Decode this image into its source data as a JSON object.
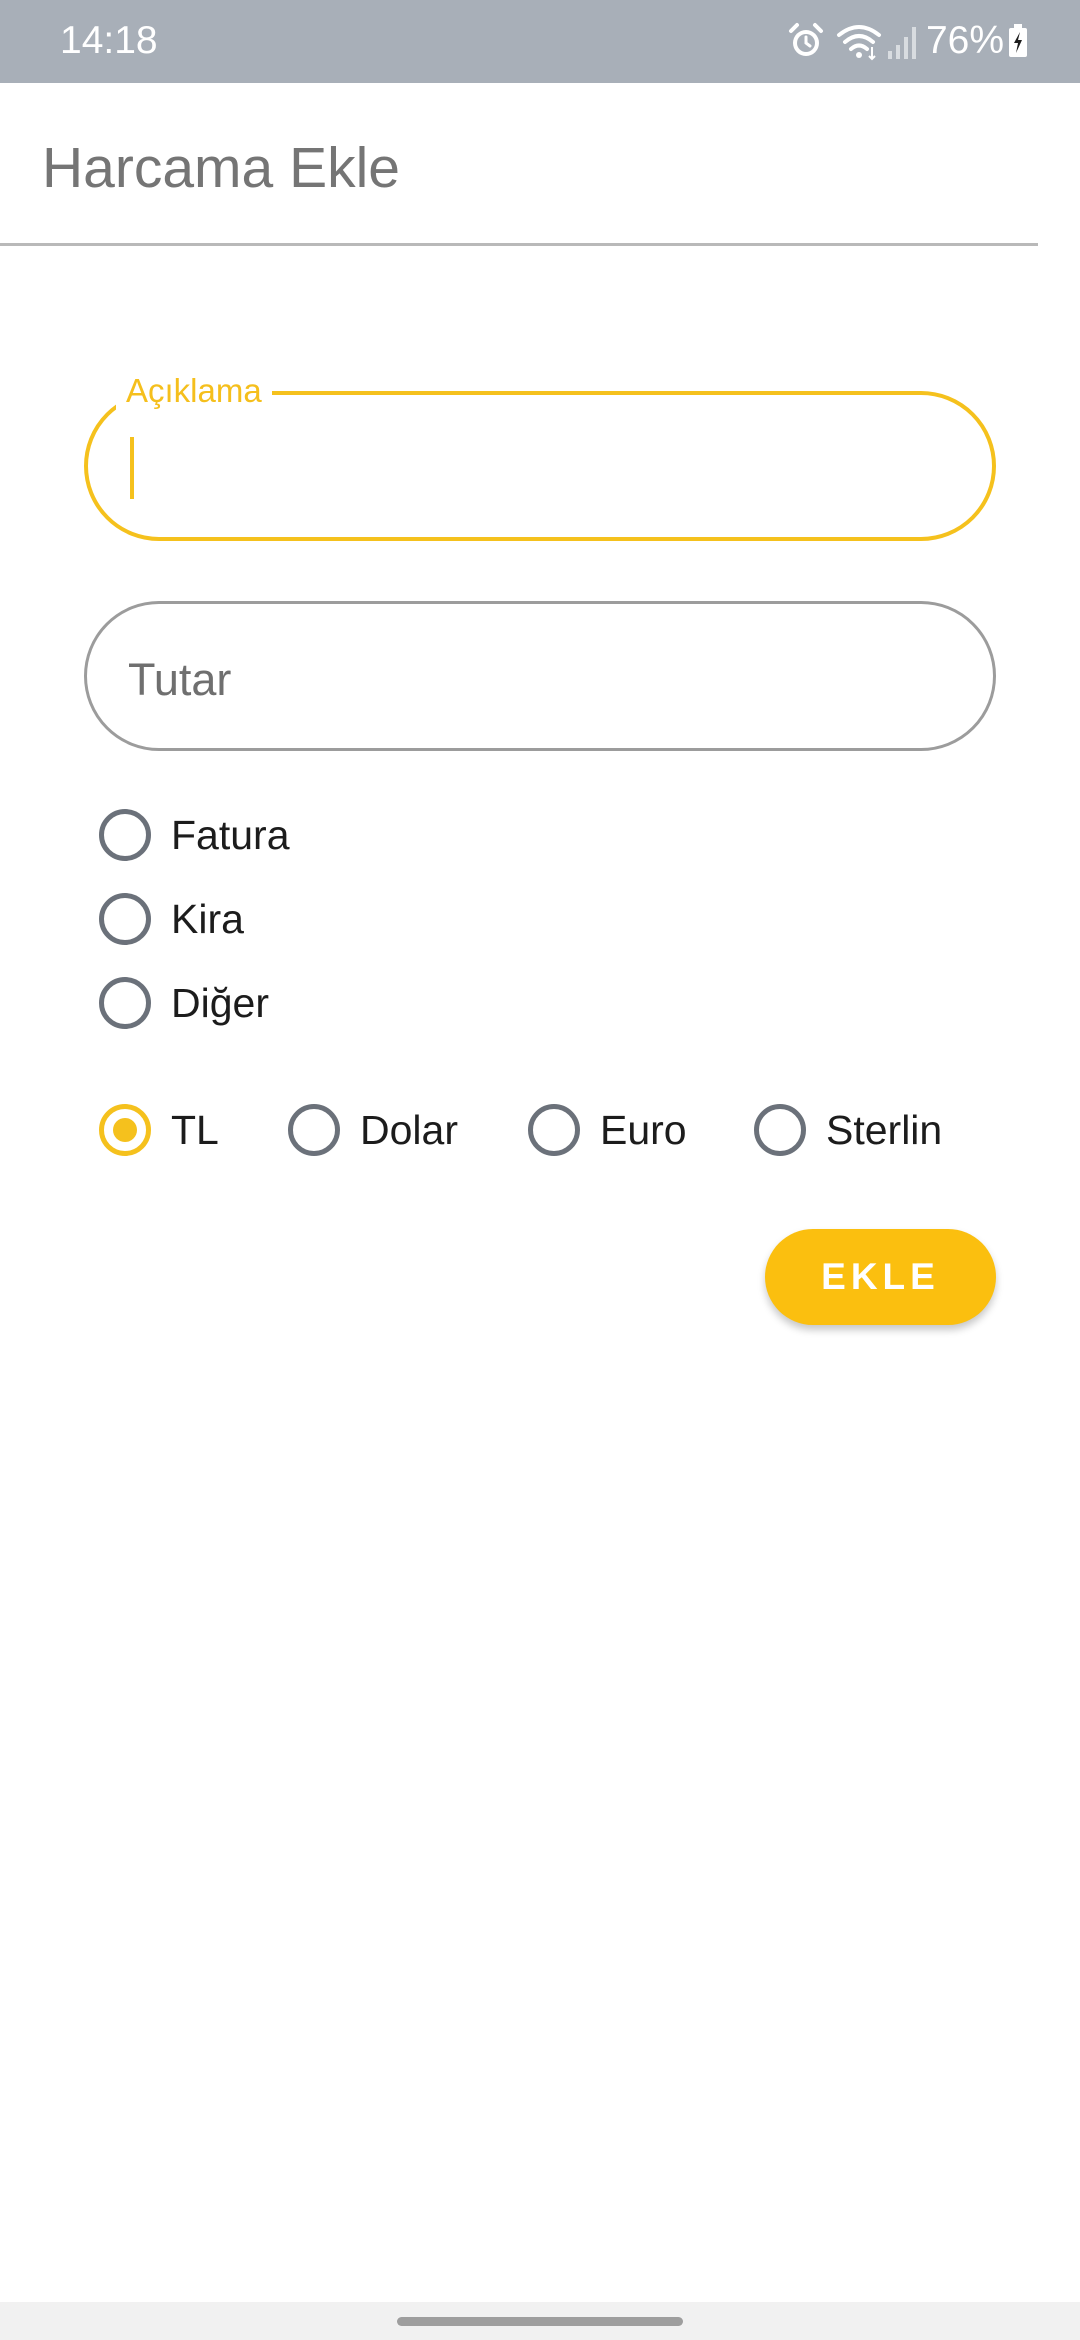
{
  "status_bar": {
    "time": "14:18",
    "battery": "76%",
    "icons": [
      "alarm-icon",
      "wifi-icon",
      "signal-icon",
      "battery-charging-icon"
    ]
  },
  "header": {
    "title": "Harcama Ekle"
  },
  "form": {
    "description": {
      "label": "Açıklama",
      "value": ""
    },
    "amount": {
      "placeholder": "Tutar",
      "value": ""
    },
    "categories": [
      {
        "label": "Fatura",
        "selected": false
      },
      {
        "label": "Kira",
        "selected": false
      },
      {
        "label": "Diğer",
        "selected": false
      }
    ],
    "currencies": [
      {
        "label": "TL",
        "selected": true
      },
      {
        "label": "Dolar",
        "selected": false
      },
      {
        "label": "Euro",
        "selected": false
      },
      {
        "label": "Sterlin",
        "selected": false
      }
    ],
    "submit_label": "EKLE"
  },
  "colors": {
    "accent": "#f5c11d",
    "button": "#fbbf0f",
    "status_bar": "#a8afb8"
  }
}
